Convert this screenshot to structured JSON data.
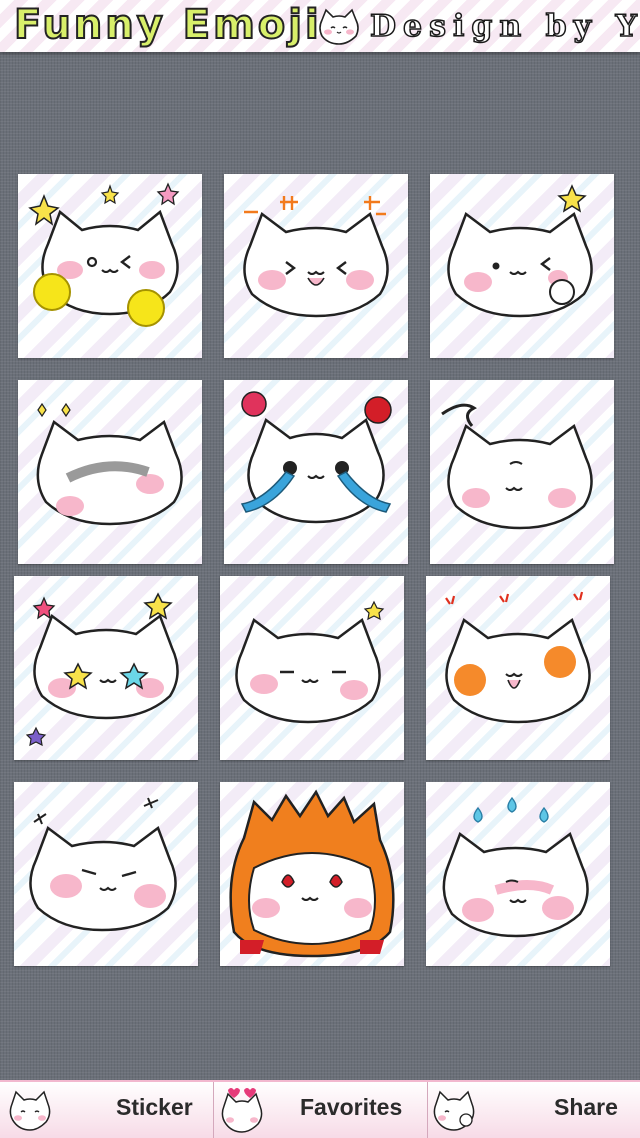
{
  "header": {
    "title": "Funny Emoji",
    "credit": "Design by Yu",
    "logo_icon": "cat-face-icon"
  },
  "colors": {
    "background": "#6b7079",
    "title_fill": "#d8ef6a",
    "tab_bar": "#f7dbe7",
    "blush_pink": "#f7b7cb",
    "blush_orange": "#f58a2b",
    "tear_blue": "#3aa4db"
  },
  "stickers": [
    {
      "name": "cheerleader-cat",
      "icon": "pom-pom-cat-sticker"
    },
    {
      "name": "excited-cat",
      "icon": "excited-cat-sticker"
    },
    {
      "name": "winking-cat",
      "icon": "wink-cat-sticker"
    },
    {
      "name": "gloomy-cat",
      "icon": "gloomy-cat-sticker"
    },
    {
      "name": "crying-with-roses-cat",
      "icon": "crying-cat-sticker"
    },
    {
      "name": "shy-cat",
      "icon": "shy-cat-sticker"
    },
    {
      "name": "starry-eyed-cat",
      "icon": "starry-eyes-cat-sticker"
    },
    {
      "name": "smug-cat",
      "icon": "smug-cat-sticker"
    },
    {
      "name": "angry-cat",
      "icon": "angry-cat-sticker"
    },
    {
      "name": "serious-cat",
      "icon": "serious-cat-sticker"
    },
    {
      "name": "fiery-cat",
      "icon": "fiery-cat-sticker"
    },
    {
      "name": "sweating-cat",
      "icon": "sweating-cat-sticker"
    }
  ],
  "tabs": [
    {
      "label": "Sticker",
      "icon": "cat-face-icon"
    },
    {
      "label": "Favorites",
      "icon": "cat-hearts-icon"
    },
    {
      "label": "Share",
      "icon": "cat-waving-icon"
    }
  ]
}
